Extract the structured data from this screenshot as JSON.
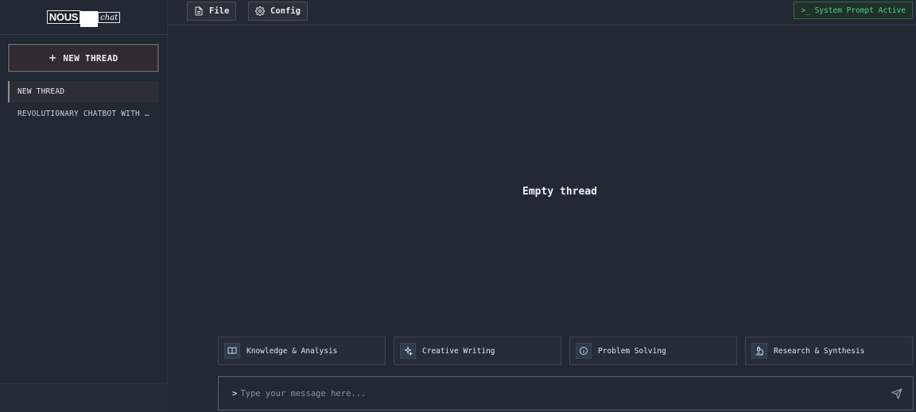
{
  "app": {
    "logo_left": "NOUS",
    "logo_right": "chat"
  },
  "sidebar": {
    "new_thread_label": "NEW THREAD",
    "threads": [
      {
        "label": "NEW THREAD",
        "active": true
      },
      {
        "label": "REVOLUTIONARY CHATBOT WITH …",
        "active": false
      }
    ]
  },
  "toolbar": {
    "file_label": "File",
    "config_label": "Config",
    "system_prompt_label": ">_ System Prompt Active"
  },
  "main": {
    "empty_label": "Empty thread",
    "suggestions": [
      {
        "label": "Knowledge & Analysis",
        "icon": "book-icon"
      },
      {
        "label": "Creative Writing",
        "icon": "sparkles-icon"
      },
      {
        "label": "Problem Solving",
        "icon": "info-icon"
      },
      {
        "label": "Research & Synthesis",
        "icon": "microscope-icon"
      }
    ],
    "input": {
      "prompt": ">",
      "placeholder": "Type your message here..."
    }
  },
  "colors": {
    "background": "#222831",
    "accent_green": "#4fd18b"
  }
}
